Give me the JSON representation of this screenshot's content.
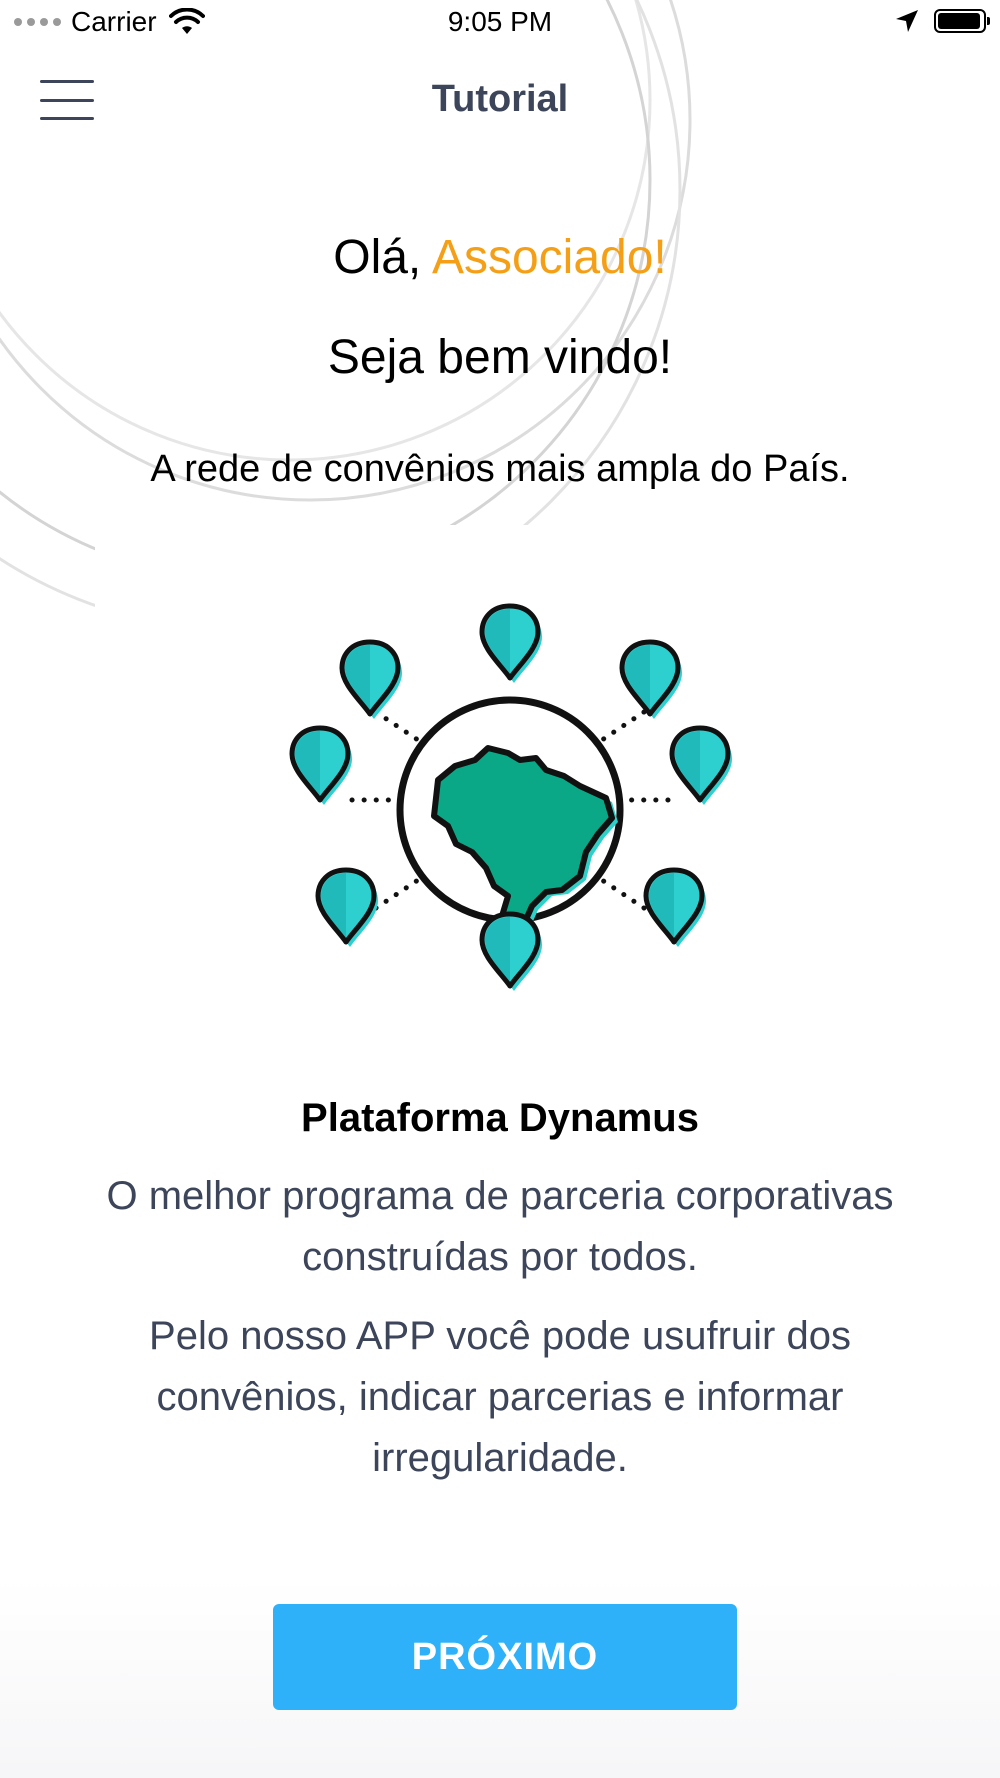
{
  "status_bar": {
    "carrier": "Carrier",
    "time": "9:05 PM",
    "battery_level": 0.95
  },
  "nav": {
    "title": "Tutorial",
    "menu_icon": "hamburger-menu-icon"
  },
  "greeting": {
    "hello": "Olá, ",
    "name": "Associado!",
    "welcome": "Seja bem vindo!",
    "tagline": "A rede de convênios mais ampla do País."
  },
  "illustration": {
    "icon": "brazil-map-with-location-pins-icon",
    "pin_color": "#2ecfcf",
    "map_color": "#0aa887"
  },
  "platform": {
    "title": "Plataforma Dynamus",
    "description": "O melhor programa de parceria corporativas construídas por todos.",
    "description_2": "Pelo nosso APP você pode usufruir dos convênios, indicar parcerias e informar irregularidade."
  },
  "footer": {
    "next_label": "PRÓXIMO"
  },
  "colors": {
    "accent_orange": "#f59f16",
    "button_blue": "#2eb1f8",
    "text_dark": "#3c4559"
  }
}
